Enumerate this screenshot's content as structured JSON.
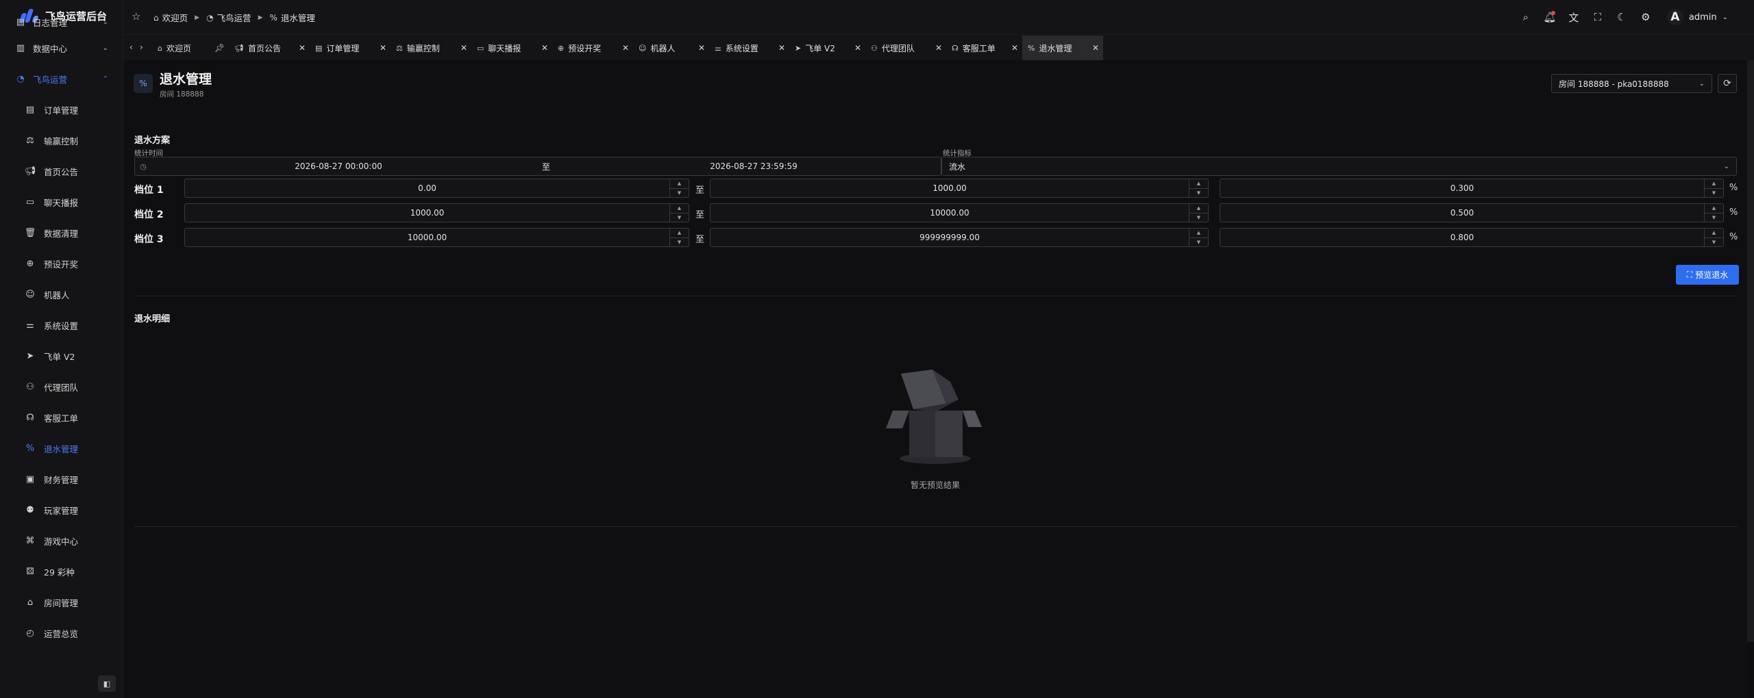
{
  "app": {
    "title": "飞鸟运营后台"
  },
  "sidebar": {
    "partial_item": {
      "label": "日志管理",
      "icon": "log-icon"
    },
    "items": [
      {
        "label": "数据中心",
        "icon": "chart-icon",
        "type": "group"
      },
      {
        "label": "飞鸟运营",
        "icon": "gauge-icon",
        "type": "group-open"
      },
      {
        "label": "订单管理",
        "icon": "document-icon"
      },
      {
        "label": "输赢控制",
        "icon": "scale-icon"
      },
      {
        "label": "首页公告",
        "icon": "megaphone-icon"
      },
      {
        "label": "聊天播报",
        "icon": "chat-icon"
      },
      {
        "label": "数据清理",
        "icon": "trash-icon"
      },
      {
        "label": "预设开奖",
        "icon": "plus-circle-icon"
      },
      {
        "label": "机器人",
        "icon": "robot-icon"
      },
      {
        "label": "系统设置",
        "icon": "sliders-icon"
      },
      {
        "label": "飞单 V2",
        "icon": "send-icon"
      },
      {
        "label": "代理团队",
        "icon": "network-icon"
      },
      {
        "label": "客服工单",
        "icon": "headset-icon"
      },
      {
        "label": "退水管理",
        "icon": "percent-icon",
        "active": true
      },
      {
        "label": "财务管理",
        "icon": "wallet-icon"
      },
      {
        "label": "玩家管理",
        "icon": "users-icon"
      },
      {
        "label": "游戏中心",
        "icon": "gamepad-icon"
      },
      {
        "label": "29 彩种",
        "icon": "dice-icon"
      },
      {
        "label": "房间管理",
        "icon": "building-icon"
      },
      {
        "label": "运营总览",
        "icon": "dashboard-icon"
      }
    ]
  },
  "header": {
    "breadcrumb": [
      {
        "label": "欢迎页",
        "icon": "home-icon"
      },
      {
        "label": "飞鸟运营",
        "icon": "gauge-icon"
      },
      {
        "label": "退水管理",
        "icon": "percent-icon"
      }
    ],
    "user": {
      "avatar_letter": "A",
      "name": "admin"
    }
  },
  "tabs": [
    {
      "label": "欢迎页",
      "icon": "home-icon",
      "pinned": true
    },
    {
      "label": "首页公告",
      "icon": "megaphone-icon"
    },
    {
      "label": "订单管理",
      "icon": "document-icon"
    },
    {
      "label": "输赢控制",
      "icon": "scale-icon"
    },
    {
      "label": "聊天播报",
      "icon": "chat-icon"
    },
    {
      "label": "预设开奖",
      "icon": "plus-circle-icon"
    },
    {
      "label": "机器人",
      "icon": "robot-icon"
    },
    {
      "label": "系统设置",
      "icon": "sliders-icon"
    },
    {
      "label": "飞单 V2",
      "icon": "send-icon"
    },
    {
      "label": "代理团队",
      "icon": "network-icon"
    },
    {
      "label": "客服工单",
      "icon": "headset-icon"
    },
    {
      "label": "退水管理",
      "icon": "percent-icon",
      "active": true
    }
  ],
  "page": {
    "title": "退水管理",
    "subtitle": "房间 188888",
    "room_select": "房间 188888 - pka0188888"
  },
  "plan": {
    "title": "退水方案",
    "time_label": "统计时间",
    "time_start": "2026-08-27 00:00:00",
    "time_to": "至",
    "time_end": "2026-08-27 23:59:59",
    "metric_label": "统计指标",
    "metric_value": "流水",
    "tiers": [
      {
        "label": "档位 1",
        "from": "0.00",
        "to": "1000.00",
        "rate": "0.300"
      },
      {
        "label": "档位 2",
        "from": "1000.00",
        "to": "10000.00",
        "rate": "0.500"
      },
      {
        "label": "档位 3",
        "from": "10000.00",
        "to": "999999999.00",
        "rate": "0.800"
      }
    ],
    "to_text": "至",
    "pct_text": "%",
    "preview_button": "预览退水"
  },
  "detail": {
    "title": "退水明细",
    "empty_text": "暂无预览结果"
  },
  "colors": {
    "accent": "#2f6df0",
    "active_nav": "#4c7df5",
    "background": "#0f0f11"
  }
}
